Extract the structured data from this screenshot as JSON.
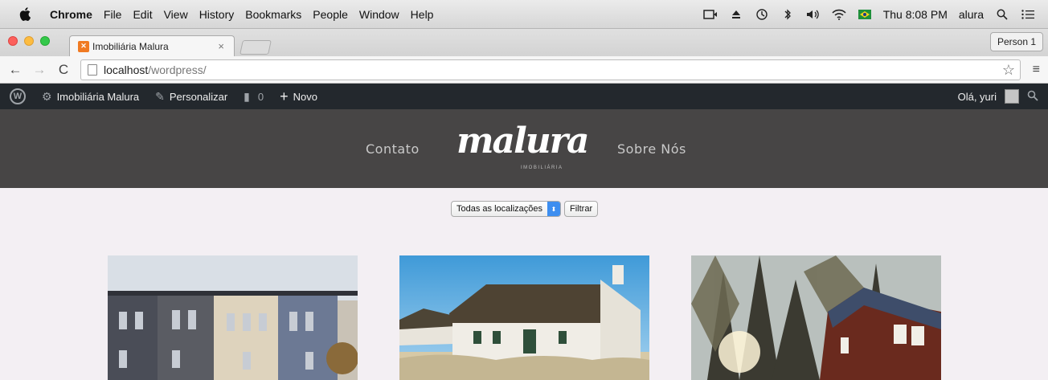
{
  "mac_menu": {
    "app": "Chrome",
    "items": [
      "File",
      "Edit",
      "View",
      "History",
      "Bookmarks",
      "People",
      "Window",
      "Help"
    ],
    "clock": "Thu 8:08 PM",
    "user": "alura"
  },
  "browser": {
    "tab": {
      "title": "Imobiliária Malura",
      "close": "×"
    },
    "person_button": "Person 1",
    "url_host": "localhost",
    "url_path": "/wordpress/"
  },
  "wp_admin_bar": {
    "site_name": "Imobiliária Malura",
    "customize": "Personalizar",
    "comments_count": "0",
    "new": "Novo",
    "greeting": "Olá, yuri"
  },
  "site": {
    "nav_left": "Contato",
    "nav_right": "Sobre Nós",
    "logo_text": "malura",
    "logo_sub": "IMOBILIÁRIA"
  },
  "filter": {
    "select_value": "Todas as localizações",
    "button": "Filtrar"
  },
  "colors": {
    "wp_bar": "#23282d",
    "header": "#474545",
    "page_bg": "#f3eff3"
  }
}
